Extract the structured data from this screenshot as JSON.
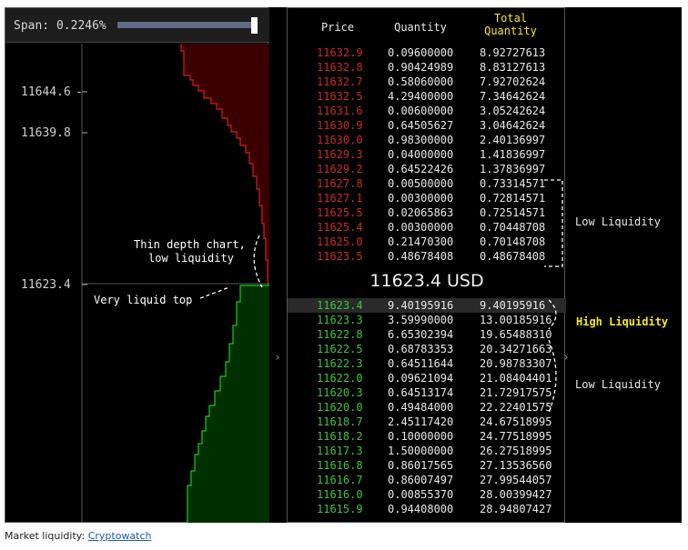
{
  "span": {
    "label": "Span: 0.2246%"
  },
  "depth_chart": {
    "tick_labels": [
      "11644.6",
      "11639.8",
      "11623.4"
    ],
    "annotations": {
      "thin": [
        "Thin depth chart,",
        "low liquidity"
      ],
      "liquid_top": "Very liquid top"
    },
    "colors": {
      "ask_fill": "#3a0000",
      "ask_line": "#d81f1f",
      "bid_fill": "#003000",
      "bid_line": "#1fc71f"
    }
  },
  "order_book": {
    "headers": {
      "price": "Price",
      "quantity": "Quantity",
      "total_line1": "Total",
      "total_line2": "Quantity"
    },
    "asks": [
      {
        "price": "11632.9",
        "qty": "0.09600000",
        "total": "8.92727613"
      },
      {
        "price": "11632.8",
        "qty": "0.90424989",
        "total": "8.83127613"
      },
      {
        "price": "11632.7",
        "qty": "0.58060000",
        "total": "7.92702624"
      },
      {
        "price": "11632.5",
        "qty": "4.29400000",
        "total": "7.34642624"
      },
      {
        "price": "11631.6",
        "qty": "0.00600000",
        "total": "3.05242624"
      },
      {
        "price": "11630.9",
        "qty": "0.64505627",
        "total": "3.04642624"
      },
      {
        "price": "11630.0",
        "qty": "0.98300000",
        "total": "2.40136997"
      },
      {
        "price": "11629.3",
        "qty": "0.04000000",
        "total": "1.41836997"
      },
      {
        "price": "11629.2",
        "qty": "0.64522426",
        "total": "1.37836997"
      },
      {
        "price": "11627.8",
        "qty": "0.00500000",
        "total": "0.73314571"
      },
      {
        "price": "11627.1",
        "qty": "0.00300000",
        "total": "0.72814571"
      },
      {
        "price": "11625.5",
        "qty": "0.02065863",
        "total": "0.72514571"
      },
      {
        "price": "11625.4",
        "qty": "0.00300000",
        "total": "0.70448708"
      },
      {
        "price": "11625.0",
        "qty": "0.21470300",
        "total": "0.70148708"
      },
      {
        "price": "11623.5",
        "qty": "0.48678408",
        "total": "0.48678408"
      }
    ],
    "mid_price": "11623.4 USD",
    "bids": [
      {
        "price": "11623.4",
        "qty": "9.40195916",
        "total": "9.40195916"
      },
      {
        "price": "11623.3",
        "qty": "3.59990000",
        "total": "13.00185916"
      },
      {
        "price": "11622.8",
        "qty": "6.65302394",
        "total": "19.65488310"
      },
      {
        "price": "11622.5",
        "qty": "0.68783353",
        "total": "20.34271663"
      },
      {
        "price": "11622.3",
        "qty": "0.64511644",
        "total": "20.98783307"
      },
      {
        "price": "11622.0",
        "qty": "0.09621094",
        "total": "21.08404401"
      },
      {
        "price": "11620.3",
        "qty": "0.64513174",
        "total": "21.72917575"
      },
      {
        "price": "11620.0",
        "qty": "0.49484000",
        "total": "22.22401575"
      },
      {
        "price": "11618.7",
        "qty": "2.45117420",
        "total": "24.67518995"
      },
      {
        "price": "11618.2",
        "qty": "0.10000000",
        "total": "24.77518995"
      },
      {
        "price": "11617.3",
        "qty": "1.50000000",
        "total": "26.27518995"
      },
      {
        "price": "11616.8",
        "qty": "0.86017565",
        "total": "27.13536560"
      },
      {
        "price": "11616.7",
        "qty": "0.86007497",
        "total": "27.99544057"
      },
      {
        "price": "11616.0",
        "qty": "0.00855370",
        "total": "28.00399427"
      },
      {
        "price": "11615.9",
        "qty": "0.94408000",
        "total": "28.94807427"
      }
    ],
    "colors": {
      "ask": "#c92a2a",
      "bid": "#3ec43e",
      "header_total": "#f5e72a"
    }
  },
  "side_annotations": {
    "low_liquidity_top": "Low Liquidity",
    "high_liquidity": "High Liquidity",
    "low_liquidity_bottom": "Low Liquidity"
  },
  "caption": {
    "prefix": "Market liquidity: ",
    "link": "Cryptowatch"
  }
}
